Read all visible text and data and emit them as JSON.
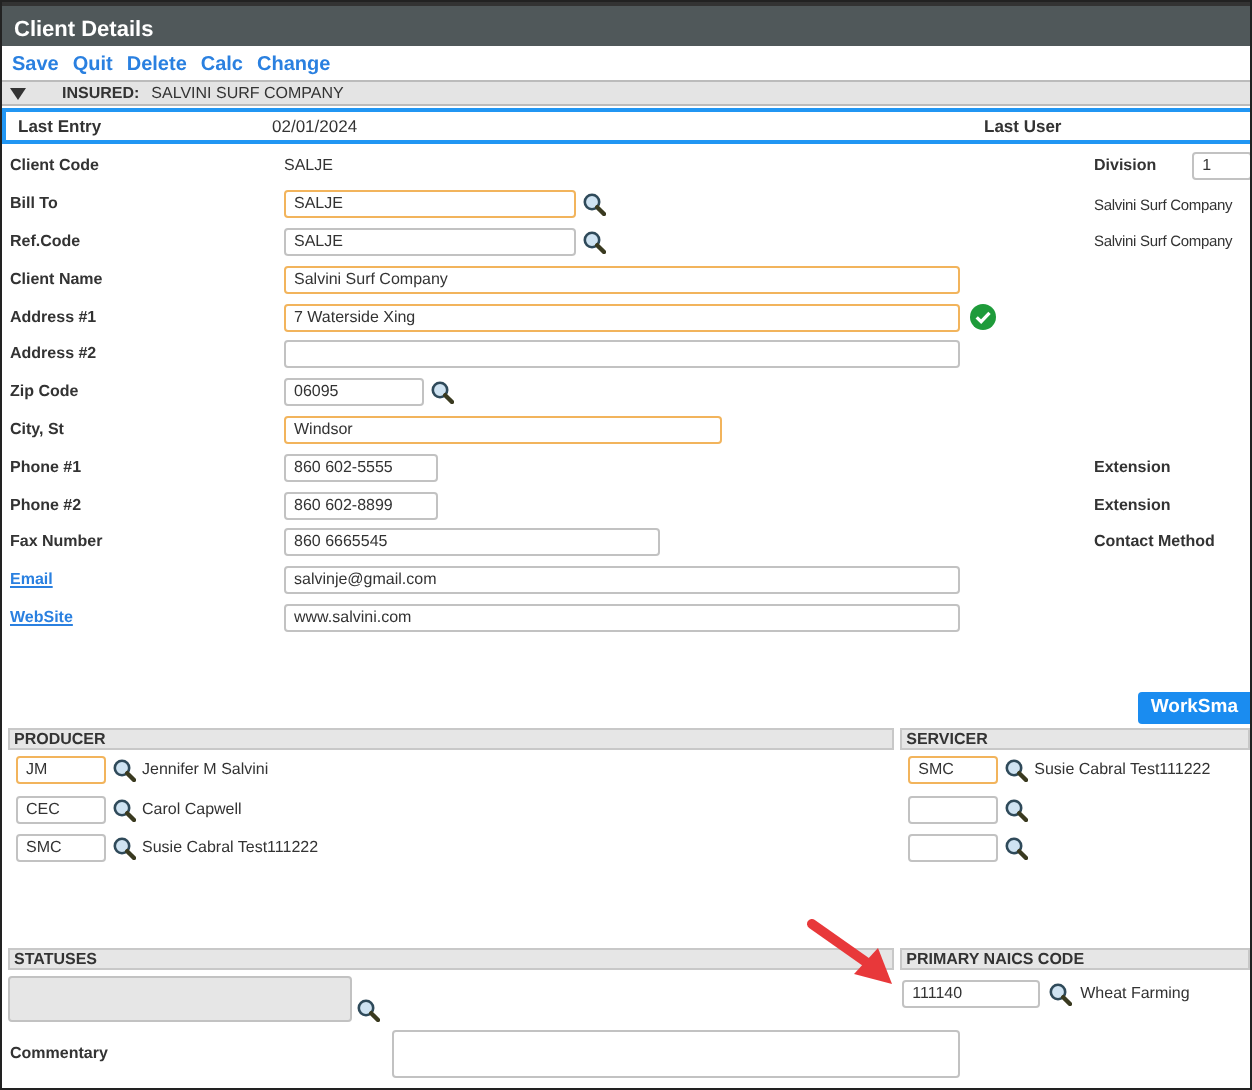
{
  "window": {
    "title": "Client Details"
  },
  "toolbar": [
    "Save",
    "Quit",
    "Delete",
    "Calc",
    "Change"
  ],
  "insured_bar": {
    "expanded": true,
    "label": "INSURED:",
    "value": "SALVINI SURF COMPANY"
  },
  "summary": {
    "last_entry_label": "Last Entry",
    "last_entry": "02/01/2024",
    "last_user_label": "Last User"
  },
  "fields": [
    {
      "label": "Client Code",
      "kind": "text",
      "value": "SALJE",
      "right_label": "Division",
      "right_input": "1"
    },
    {
      "label": "Bill To",
      "kind": "input",
      "value": "SALJE",
      "highlighted": true,
      "lookup": true,
      "right_text": "Salvini Surf Company"
    },
    {
      "label": "Ref.Code",
      "kind": "input",
      "value": "SALJE",
      "highlighted": false,
      "lookup": true,
      "right_text": "Salvini Surf Company"
    },
    {
      "label": "Client Name",
      "kind": "input",
      "value": "Salvini Surf Company",
      "highlighted": true
    },
    {
      "label": "Address #1",
      "kind": "input",
      "value": "7 Waterside Xing",
      "highlighted": true,
      "valid": true
    },
    {
      "label": "Address #2",
      "kind": "input",
      "highlighted": false
    },
    {
      "label": "Zip Code",
      "kind": "input",
      "value": "06095",
      "highlighted": false,
      "lookup": true
    },
    {
      "label": "City, St",
      "kind": "input",
      "value": "Windsor",
      "highlighted": true
    },
    {
      "label": "Phone #1",
      "kind": "input",
      "value": "860 602-5555",
      "highlighted": false,
      "right_label": "Extension"
    },
    {
      "label": "Phone #2",
      "kind": "input",
      "value": "860 602-8899",
      "highlighted": false,
      "right_label": "Extension"
    },
    {
      "label": "Fax Number",
      "kind": "input",
      "value": "860 6665545",
      "highlighted": false,
      "right_label": "Contact Method"
    },
    {
      "label": "Email",
      "label_link": true,
      "kind": "input",
      "value": "salvinje@gmail.com",
      "highlighted": false
    },
    {
      "label": "WebSite",
      "label_link": true,
      "kind": "input",
      "value": "www.salvini.com",
      "highlighted": false
    }
  ],
  "worksmart_button": "WorkSma",
  "producer": {
    "title": "PRODUCER",
    "rows": [
      {
        "code": "JM",
        "highlighted": true,
        "name": "Jennifer M Salvini"
      },
      {
        "code": "CEC",
        "highlighted": false,
        "name": "Carol Capwell"
      },
      {
        "code": "SMC",
        "highlighted": false,
        "name": "Susie Cabral Test111222"
      }
    ]
  },
  "servicer": {
    "title": "SERVICER",
    "rows": [
      {
        "code": "SMC",
        "highlighted": true,
        "name": "Susie Cabral Test111222"
      },
      {
        "highlighted": false
      },
      {
        "highlighted": false
      }
    ]
  },
  "statuses": {
    "title": "STATUSES",
    "disabled": true
  },
  "naics": {
    "title": "PRIMARY NAICS CODE",
    "code": "111140",
    "description": "Wheat Farming"
  },
  "commentary": {
    "label": "Commentary"
  }
}
